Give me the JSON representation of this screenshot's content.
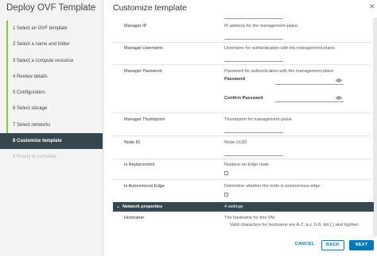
{
  "wizard": {
    "title": "Deploy OVF Template",
    "steps": [
      {
        "label": "1  Select an OVF template"
      },
      {
        "label": "2  Select a name and folder"
      },
      {
        "label": "3  Select a compute resource"
      },
      {
        "label": "4  Review details"
      },
      {
        "label": "5  Configuration"
      },
      {
        "label": "6  Select storage"
      },
      {
        "label": "7  Select networks"
      },
      {
        "label": "8  Customize template"
      },
      {
        "label": "9  Ready to complete"
      }
    ],
    "active_step": 8
  },
  "main": {
    "title": "Customize template",
    "fields": {
      "manager_ip": {
        "label": "Manager IP",
        "description": "IP address for the management-plane."
      },
      "manager_username": {
        "label": "Manager Username",
        "description": "Username for authentication with the management-plane."
      },
      "manager_password": {
        "label": "Manager Password",
        "description": "Password for authentication with the management-plane.",
        "password_label": "Password",
        "confirm_label": "Confirm Password"
      },
      "manager_thumbprint": {
        "label": "Manager Thumbprint",
        "description": "Thumbprint for management-plane."
      },
      "node_id": {
        "label": "Node ID",
        "description": "Node UUID"
      },
      "is_replacement": {
        "label": "Is Replacement",
        "description": "Replace an Edge node."
      },
      "is_autonomous_edge": {
        "label": "Is Autonomous Edge",
        "description": "Determine whether the node is autonomous edge."
      }
    },
    "network_properties": {
      "label": "Network properties",
      "count": "4 settings",
      "hostname": {
        "label": "Hostname",
        "description": "The hostname for this VM.",
        "hint": "Valid characters for hostname are A-Z, a-z, 0-9, dot (.) and hyphen"
      }
    }
  },
  "footer": {
    "cancel_label": "CANCEL",
    "back_label": "BACK",
    "next_label": "NEXT"
  },
  "colors": {
    "accent": "#0079b8",
    "active_step_bg": "#37474f",
    "completed_step_bar": "#8cc63f"
  },
  "icons": {
    "close": "close-icon",
    "show_password": "eye-icon",
    "collapse": "chevron-down-icon"
  }
}
